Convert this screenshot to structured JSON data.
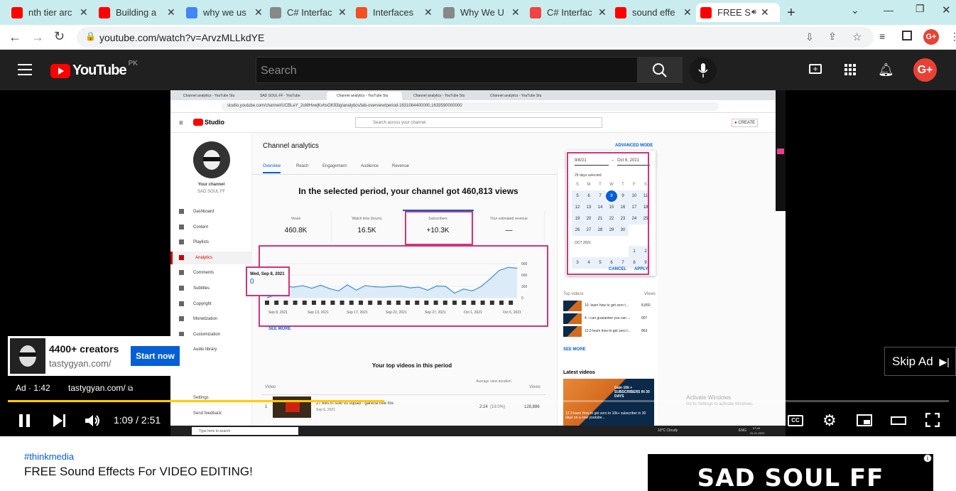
{
  "browser": {
    "tabs": [
      {
        "title": "nth tier arc",
        "icon": "youtube-icon",
        "color": "#ff0000"
      },
      {
        "title": "Building a",
        "icon": "youtube-icon",
        "color": "#ff0000"
      },
      {
        "title": "why we us",
        "icon": "google-icon",
        "color": "#4285f4"
      },
      {
        "title": "C# Interfac",
        "icon": "web-icon",
        "color": "#888888"
      },
      {
        "title": "Interfaces",
        "icon": "microsoft-icon",
        "color": "#f25022"
      },
      {
        "title": "Why We U",
        "icon": "web-icon",
        "color": "#888888"
      },
      {
        "title": "C# Interfac",
        "icon": "web-icon",
        "color": "#e44"
      },
      {
        "title": "sound effe",
        "icon": "youtube-icon",
        "color": "#ff0000"
      },
      {
        "title": "FREE S",
        "icon": "youtube-icon",
        "color": "#ff0000"
      }
    ],
    "url": "youtube.com/watch?v=ArvzMLLkdYE"
  },
  "youtube": {
    "logo": "YouTube",
    "region": "PK",
    "search_placeholder": "Search"
  },
  "studio": {
    "inner_tabs": [
      "Channel analytics - YouTube Stu",
      "SAD SOUL FF - YouTube",
      "Channel analytics - YouTube Stu",
      "Channel analytics - YouTube Stu",
      "Channel analytics - YouTube Stu"
    ],
    "inner_url": "studio.youtube.com/channel/UCBLeY_2oMHvwjKvhsGK93ig/analytics/tab-overview/period-1631084400000,1633590000000",
    "logo": "Studio",
    "search": "Search across your channel",
    "create": "CREATE",
    "channel_label": "Your channel",
    "channel_name": "SAD SOUL FF",
    "nav": [
      "Dashboard",
      "Content",
      "Playlists",
      "Analytics",
      "Comments",
      "Subtitles",
      "Copyright",
      "Monetization",
      "Customization",
      "Audio library"
    ],
    "settings": "Settings",
    "feedback": "Send feedback",
    "page_title": "Channel analytics",
    "advanced": "ADVANCED MODE",
    "subtabs": [
      "Overview",
      "Reach",
      "Engagement",
      "Audience",
      "Revenue"
    ],
    "headline": "In the selected period, your channel got 460,813 views",
    "stats": [
      {
        "label": "Views",
        "value": "460.8K"
      },
      {
        "label": "Watch time (hours)",
        "value": "16.5K"
      },
      {
        "label": "Subscribers",
        "value": "+10.3K"
      },
      {
        "label": "Your estimated revenue",
        "value": "—"
      }
    ],
    "chart_tooltip_date": "Wed, Sep 8, 2021",
    "chart_tooltip_value": "0",
    "x_ticks": [
      "Sep 8, 2021",
      "Sep 13, 2021",
      "Sep 17, 2021",
      "Sep 22, 2021",
      "Sep 27, 2021",
      "Oct 1, 2021",
      "Oct 6, 2021"
    ],
    "y_ticks": [
      "900",
      "600",
      "300",
      "0"
    ],
    "see_more": "SEE MORE",
    "top_videos_title": "Your top videos in this period",
    "table_headers": [
      "Video",
      "Average view duration",
      "Views"
    ],
    "top_row": {
      "rank": "1",
      "title": "27 kills in solo vs squad - garena free fire",
      "date": "Sep 6, 2021",
      "avg": "2:24",
      "pct": "(19.0%)",
      "views": "128,886"
    },
    "date_range": {
      "start": "9/8/21",
      "end": "Oct 6, 2021",
      "selected": "29 days selected",
      "month2": "OCT 2021",
      "cancel": "CANCEL",
      "apply": "APPLY"
    },
    "weekdays": [
      "S",
      "M",
      "T",
      "W",
      "T",
      "F",
      "S"
    ],
    "cal_rows": [
      [
        "5",
        "6",
        "7",
        "8",
        "9",
        "10",
        "11"
      ],
      [
        "12",
        "13",
        "14",
        "15",
        "16",
        "17",
        "18"
      ],
      [
        "19",
        "20",
        "21",
        "22",
        "23",
        "24",
        "25"
      ],
      [
        "26",
        "27",
        "28",
        "29",
        "30",
        "",
        ""
      ]
    ],
    "oct_rows": [
      [
        "",
        "",
        "",
        "",
        "",
        "1",
        "2"
      ],
      [
        "3",
        "4",
        "5",
        "6",
        "7",
        "8",
        "9"
      ]
    ],
    "top_videos_side_title": "Top videos",
    "side_views_label": "Views",
    "side_videos": [
      {
        "title": "10. learn how to get zero t...",
        "views": "8,860"
      },
      {
        "title": "4. i can guarantee you can ...",
        "views": "907"
      },
      {
        "title": "12.5 learn how to get zero t...",
        "views": "863"
      }
    ],
    "side_see_more": "SEE MORE",
    "latest_videos": "Latest videos",
    "latest_caption": "12.3 learn How to get zero to 10k+ subscriber in 30 days on a new youtube...",
    "thumb_text": "Gain 10k + SUBSCRIBERS IN 30 DAYS",
    "activate": "Activate Windows",
    "activate_sub": "Go to Settings to activate Windows.",
    "taskbar_search": "Type here to search",
    "weather": "10°C Cloudy",
    "lang": "ENG",
    "clock": "07:45",
    "date": "31-01-2022"
  },
  "ad": {
    "title": "4400+ creators",
    "domain": "tastygyan.com/",
    "cta": "Start now",
    "ad_label": "Ad · 1:42",
    "ad_link": "tastygyan.com/",
    "skip": "Skip Ad"
  },
  "controls": {
    "time": "1:09 / 2:51",
    "progress": 0.4
  },
  "video": {
    "hashtag": "#thinkmedia",
    "title": "FREE Sound Effects For VIDEO EDITING!",
    "sidebar_ad_text": "SAD SOUL FF"
  },
  "chart_data": {
    "type": "line",
    "x": [
      "Sep 8, 2021",
      "Sep 13, 2021",
      "Sep 17, 2021",
      "Sep 22, 2021",
      "Sep 27, 2021",
      "Oct 1, 2021",
      "Oct 6, 2021"
    ],
    "series": [
      {
        "values": [
          0,
          80,
          300,
          280,
          320,
          250,
          330,
          240,
          180,
          340,
          200,
          320,
          290,
          280,
          300,
          310,
          260,
          280,
          200,
          310,
          300,
          120,
          230,
          180,
          300,
          500,
          720,
          800,
          780
        ]
      }
    ],
    "ylim": [
      0,
      900
    ],
    "y_ticks": [
      900,
      600,
      300,
      0
    ]
  }
}
